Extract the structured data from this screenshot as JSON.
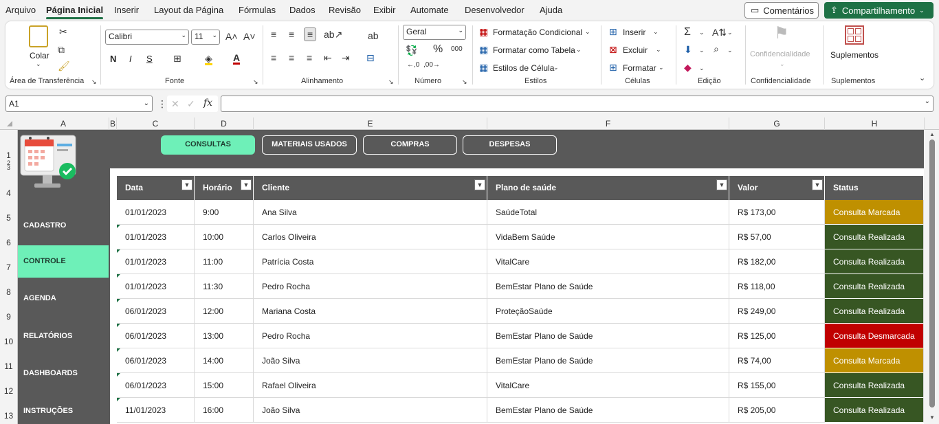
{
  "menu": {
    "items": [
      "Arquivo",
      "Página Inicial",
      "Inserir",
      "Layout da Página",
      "Fórmulas",
      "Dados",
      "Revisão",
      "Exibir",
      "Automate",
      "Desenvolvedor",
      "Ajuda"
    ],
    "comments": "Comentários",
    "share": "Compartilhamento"
  },
  "ribbon": {
    "clipboard": {
      "paste": "Colar",
      "label": "Área de Transferência"
    },
    "font": {
      "name": "Calibri",
      "size": "11",
      "label": "Fonte",
      "bold": "N",
      "italic": "I",
      "underline": "S"
    },
    "alignment": {
      "label": "Alinhamento"
    },
    "number": {
      "format": "Geral",
      "label": "Número"
    },
    "styles": {
      "conditional": "Formatação Condicional",
      "table": "Formatar como Tabela",
      "cell": "Estilos de Célula",
      "label": "Estilos"
    },
    "cells": {
      "insert": "Inserir",
      "delete": "Excluir",
      "format": "Formatar",
      "label": "Células"
    },
    "editing": {
      "label": "Edição"
    },
    "sensitivity": {
      "btn": "Confidencialidade",
      "label": "Confidencialidade"
    },
    "addins": {
      "btn": "Suplementos",
      "label": "Suplementos"
    }
  },
  "formula_bar": {
    "namebox": "A1",
    "value": ""
  },
  "columns": [
    "A",
    "B",
    "C",
    "D",
    "E",
    "F",
    "G",
    "H"
  ],
  "rows": [
    "1",
    "2",
    "3",
    "4",
    "5",
    "6",
    "7",
    "8",
    "9",
    "10",
    "11",
    "12",
    "13"
  ],
  "nav": {
    "consultas": "CONSULTAS",
    "materiais": "MATERIAIS USADOS",
    "compras": "COMPRAS",
    "despesas": "DESPESAS"
  },
  "sidebar": [
    "CADASTRO",
    "CONTROLE",
    "AGENDA",
    "RELATÓRIOS",
    "DASHBOARDS",
    "INSTRUÇÕES"
  ],
  "table": {
    "headers": [
      "Data",
      "Horário",
      "Cliente",
      "Plano de saúde",
      "Valor",
      "Status"
    ],
    "rows": [
      {
        "data": "01/01/2023",
        "hora": "9:00",
        "cliente": "Ana Silva",
        "plano": "SaúdeTotal",
        "valor": "R$ 173,00",
        "status": "Consulta Marcada"
      },
      {
        "data": "01/01/2023",
        "hora": "10:00",
        "cliente": "Carlos Oliveira",
        "plano": "VidaBem Saúde",
        "valor": "R$ 57,00",
        "status": "Consulta Realizada"
      },
      {
        "data": "01/01/2023",
        "hora": "11:00",
        "cliente": "Patrícia Costa",
        "plano": "VitalCare",
        "valor": "R$ 182,00",
        "status": "Consulta Realizada"
      },
      {
        "data": "01/01/2023",
        "hora": "11:30",
        "cliente": "Pedro Rocha",
        "plano": "BemEstar Plano de Saúde",
        "valor": "R$ 118,00",
        "status": "Consulta Realizada"
      },
      {
        "data": "06/01/2023",
        "hora": "12:00",
        "cliente": "Mariana Costa",
        "plano": "ProteçãoSaúde",
        "valor": "R$ 249,00",
        "status": "Consulta Realizada"
      },
      {
        "data": "06/01/2023",
        "hora": "13:00",
        "cliente": "Pedro Rocha",
        "plano": "BemEstar Plano de Saúde",
        "valor": "R$ 125,00",
        "status": "Consulta Desmarcada"
      },
      {
        "data": "06/01/2023",
        "hora": "14:00",
        "cliente": "João Silva",
        "plano": "BemEstar Plano de Saúde",
        "valor": "R$ 74,00",
        "status": "Consulta Marcada"
      },
      {
        "data": "06/01/2023",
        "hora": "15:00",
        "cliente": "Rafael Oliveira",
        "plano": "VitalCare",
        "valor": "R$ 155,00",
        "status": "Consulta Realizada"
      },
      {
        "data": "11/01/2023",
        "hora": "16:00",
        "cliente": "João Silva",
        "plano": "BemEstar Plano de Saúde",
        "valor": "R$ 205,00",
        "status": "Consulta Realizada"
      }
    ]
  },
  "status_colors": {
    "Consulta Marcada": "#bf9000",
    "Consulta Realizada": "#375623",
    "Consulta Desmarcada": "#c00000"
  },
  "colors": {
    "accent": "#1e7145",
    "dark": "#595959",
    "mint": "#6ef0b8"
  }
}
